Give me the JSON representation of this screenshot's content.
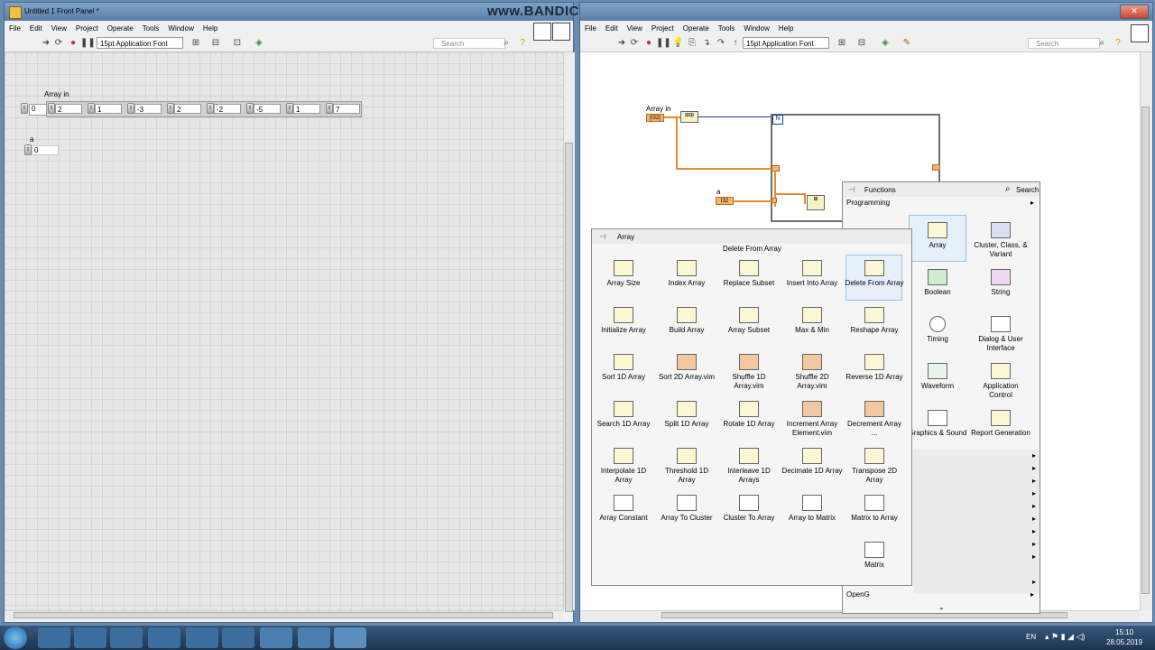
{
  "watermark": "www.BANDICAM.com",
  "front_panel": {
    "title": "Untitled 1 Front Panel *",
    "menu": [
      "File",
      "Edit",
      "View",
      "Project",
      "Operate",
      "Tools",
      "Window",
      "Help"
    ],
    "font_selector": "15pt Application Font",
    "search_placeholder": "Search",
    "array_label": "Array in",
    "array_index": "0",
    "array_values": [
      "2",
      "1",
      "-3",
      "2",
      "-2",
      "-5",
      "1",
      "7"
    ],
    "scalar_label": "a",
    "scalar_value": "0"
  },
  "block_diagram": {
    "menu": [
      "File",
      "Edit",
      "View",
      "Project",
      "Operate",
      "Tools",
      "Window",
      "Help"
    ],
    "font_selector": "15pt Application Font",
    "search_placeholder": "Search",
    "array_terminal_label": "Array in",
    "array_terminal_text": "[I32]",
    "scalar_terminal_label": "a",
    "scalar_terminal_text": "I32",
    "loop_count_terminal": "N"
  },
  "functions_palette": {
    "title": "Functions",
    "search_label": "Search",
    "category": "Programming",
    "items": [
      {
        "label": "Array"
      },
      {
        "label": "Cluster, Class, & Variant"
      },
      {
        "label": "Boolean"
      },
      {
        "label": "String"
      },
      {
        "label": "Timing"
      },
      {
        "label": "Dialog & User Interface"
      },
      {
        "label": "Waveform"
      },
      {
        "label": "Application Control"
      },
      {
        "label": "Graphics & Sound"
      },
      {
        "label": "Report Generation"
      }
    ],
    "bottom_item": "OpenG"
  },
  "array_palette": {
    "title": "Array",
    "tooltip": "Delete From Array",
    "items": [
      {
        "label": "Array Size",
        "style": "yellow"
      },
      {
        "label": "Index Array",
        "style": "yellow"
      },
      {
        "label": "Replace Subset",
        "style": "yellow"
      },
      {
        "label": "Insert Into Array",
        "style": "yellow"
      },
      {
        "label": "Delete From Array",
        "style": "yellow"
      },
      {
        "label": "Initialize Array",
        "style": "yellow"
      },
      {
        "label": "Build Array",
        "style": "yellow"
      },
      {
        "label": "Array Subset",
        "style": "yellow"
      },
      {
        "label": "Max & Min",
        "style": "yellow"
      },
      {
        "label": "Reshape Array",
        "style": "yellow"
      },
      {
        "label": "Sort 1D Array",
        "style": "yellow"
      },
      {
        "label": "Sort 2D Array.vim",
        "style": "orange"
      },
      {
        "label": "Shuffle 1D Array.vim",
        "style": "orange"
      },
      {
        "label": "Shuffle 2D Array.vim",
        "style": "orange"
      },
      {
        "label": "Reverse 1D Array",
        "style": "yellow"
      },
      {
        "label": "Search 1D Array",
        "style": "yellow"
      },
      {
        "label": "Split 1D Array",
        "style": "yellow"
      },
      {
        "label": "Rotate 1D Array",
        "style": "yellow"
      },
      {
        "label": "Increment Array Element.vim",
        "style": "orange"
      },
      {
        "label": "Decrement Array ...",
        "style": "orange"
      },
      {
        "label": "Interpolate 1D Array",
        "style": "yellow"
      },
      {
        "label": "Threshold 1D Array",
        "style": "yellow"
      },
      {
        "label": "Interleave 1D Arrays",
        "style": "yellow"
      },
      {
        "label": "Decimate 1D Array",
        "style": "yellow"
      },
      {
        "label": "Transpose 2D Array",
        "style": "yellow"
      },
      {
        "label": "Array Constant",
        "style": "plain"
      },
      {
        "label": "Array To Cluster",
        "style": "plain"
      },
      {
        "label": "Cluster To Array",
        "style": "plain"
      },
      {
        "label": "Array to Matrix",
        "style": "plain"
      },
      {
        "label": "Matrix to Array",
        "style": "plain"
      },
      {
        "label": "Matrix",
        "style": "plain"
      }
    ]
  },
  "taskbar": {
    "language": "EN",
    "time": "15:10",
    "date": "28.05.2019"
  }
}
